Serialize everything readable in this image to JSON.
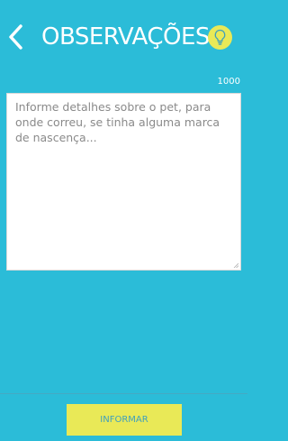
{
  "header": {
    "title": "OBSERVAÇÕES",
    "back_icon": "chevron-left-icon",
    "hint_icon": "lightbulb-icon"
  },
  "form": {
    "char_counter": "1000",
    "observations_placeholder": "Informe detalhes sobre o pet, para onde correu, se tinha alguma marca de nascença...",
    "observations_value": ""
  },
  "footer": {
    "submit_label": "INFORMAR"
  },
  "colors": {
    "background": "#2bbcd8",
    "accent_yellow": "#e9e957",
    "button_text": "#3fa0bd"
  }
}
